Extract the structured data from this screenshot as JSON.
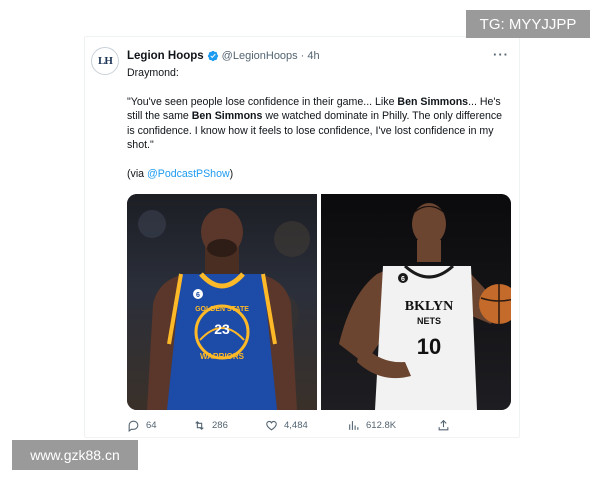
{
  "tweet": {
    "display_name": "Legion Hoops",
    "handle": "@LegionHoops",
    "separator": "·",
    "time": "4h",
    "more_label": "···",
    "avatar_text": "LH",
    "intro": "Draymond:",
    "quote_parts": [
      "\"You've seen people lose confidence in their game... Like ",
      "Ben Simmons",
      "... He's still the same ",
      "Ben Simmons",
      " we watched dominate in Philly. The only difference is confidence. I know how it feels to lose confidence, I've lost confidence in my shot.\""
    ],
    "via_prefix": "(via ",
    "via_mention": "@PodcastPShow",
    "via_suffix": ")",
    "left_jersey": {
      "line1": "GOLDEN STATE",
      "line2": "WARRIORS",
      "number": "23",
      "tag_number": "6"
    },
    "right_jersey": {
      "line1": "BKLYN",
      "line2": "NETS",
      "number": "10",
      "tag_number": "6"
    }
  },
  "actions": {
    "replies": "64",
    "retweets": "286",
    "likes": "4,484",
    "views": "612.8K"
  },
  "watermarks": {
    "top_right": "TG: MYYJJPP",
    "bottom_left": "www.gzk88.cn"
  },
  "colors": {
    "link": "#1d9bf0",
    "secondary_text": "#536471",
    "warriors_blue": "#1d4ba8",
    "warriors_gold": "#fdb927"
  }
}
